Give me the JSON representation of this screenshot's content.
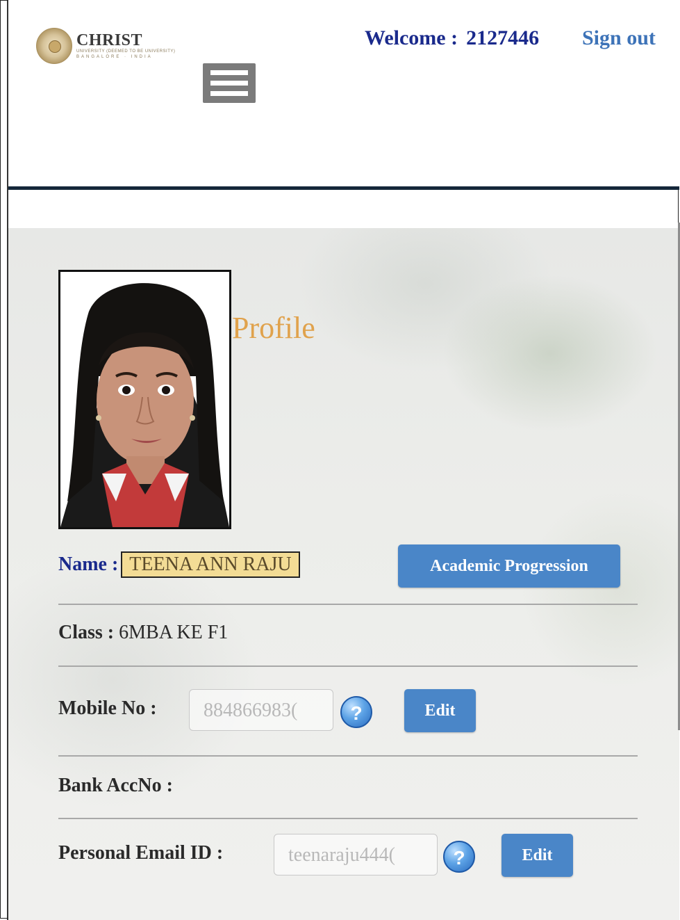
{
  "header": {
    "logo": {
      "name": "CHRIST",
      "sub1": "UNIVERSITY (DEEMED TO BE UNIVERSITY)",
      "sub2": "BANGALORE · INDIA"
    },
    "welcome_label": "Welcome :",
    "user_id": "2127446",
    "signout_label": "Sign out",
    "menu_icon": "hamburger-menu-icon"
  },
  "profile": {
    "title": "Profile",
    "name_label": "Name :",
    "name_value": "TEENA ANN RAJU",
    "academic_button": "Academic Progression",
    "class_label": "Class :",
    "class_value": "6MBA KE F1",
    "mobile_label": "Mobile No :",
    "mobile_value": "884866983(",
    "mobile_edit": "Edit",
    "bank_label": "Bank AccNo :",
    "email_label": "Personal Email ID :",
    "email_value": "teenaraju444(",
    "email_edit": "Edit",
    "help_glyph": "?"
  },
  "colors": {
    "accent_blue": "#4a86c8",
    "title_orange": "#e0a24c",
    "name_highlight": "#f3dc95",
    "navy": "#1a2a8c"
  }
}
